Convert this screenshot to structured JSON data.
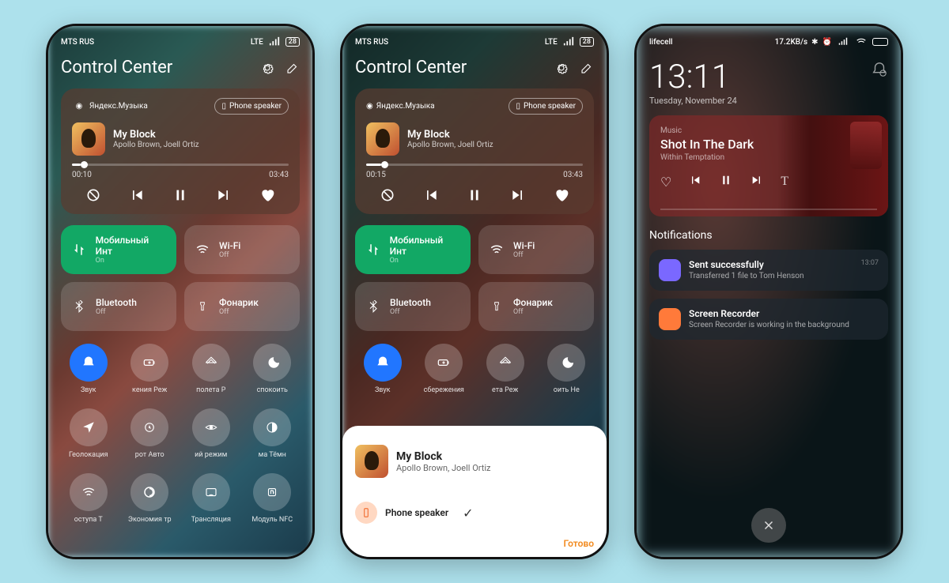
{
  "p1": {
    "status": {
      "carrier": "MTS RUS",
      "net": "LTE",
      "battery": "28"
    },
    "title": "Control Center",
    "music": {
      "source": "Яндекс.Музыка",
      "speaker": "Phone speaker",
      "track": "My Block",
      "artist": "Apollo Brown, Joell Ortiz",
      "elapsed": "00:10",
      "total": "03:43"
    },
    "tiles": [
      {
        "label": "Мобильный Инт",
        "state": "On",
        "on": true
      },
      {
        "label": "Wi-Fi",
        "state": "Off",
        "on": false
      },
      {
        "label": "Bluetooth",
        "state": "Off",
        "on": false
      },
      {
        "label": "Фонарик",
        "state": "Off",
        "on": false
      }
    ],
    "round": [
      {
        "label": "Звук",
        "on": true
      },
      {
        "label": "кения Реж"
      },
      {
        "label": "полета Р"
      },
      {
        "label": "спокоить"
      },
      {
        "label": "Геолокация"
      },
      {
        "label": "рот Авто"
      },
      {
        "label": "ий режим"
      },
      {
        "label": "ма Тёмн"
      },
      {
        "label": "оступа Т"
      },
      {
        "label": "Экономия тр"
      },
      {
        "label": "Трансляция"
      },
      {
        "label": "Модуль NFC"
      }
    ]
  },
  "p2": {
    "status": {
      "carrier": "MTS RUS",
      "net": "LTE",
      "battery": "28"
    },
    "title": "Control Center",
    "music": {
      "source": "Яндекс.Музыка",
      "speaker": "Phone speaker",
      "track": "My Block",
      "artist": "Apollo Brown, Joell Ortiz",
      "elapsed": "00:15",
      "total": "03:43"
    },
    "tiles": [
      {
        "label": "Мобильный Инт",
        "state": "On",
        "on": true
      },
      {
        "label": "Wi-Fi",
        "state": "Off",
        "on": false
      },
      {
        "label": "Bluetooth",
        "state": "Off",
        "on": false
      },
      {
        "label": "Фонарик",
        "state": "Off",
        "on": false
      }
    ],
    "round": [
      {
        "label": "Звук",
        "on": true
      },
      {
        "label": "сбережения"
      },
      {
        "label": "ета Реж"
      },
      {
        "label": "оить Не"
      }
    ],
    "sheet": {
      "track": "My Block",
      "artist": "Apollo Brown, Joell Ortiz",
      "option": "Phone speaker",
      "done": "Готово"
    }
  },
  "p3": {
    "status": {
      "carrier": "lifecell",
      "rate": "17.2KB/s"
    },
    "time": "13:11",
    "date": "Tuesday, November 24",
    "music": {
      "app": "Music",
      "track": "Shot In The Dark",
      "artist": "Within Temptation"
    },
    "notif_header": "Notifications",
    "notifs": [
      {
        "title": "Sent successfully",
        "desc": "Transferred 1 file to Tom Henson",
        "time": "13:07"
      },
      {
        "title": "Screen Recorder",
        "desc": "Screen Recorder is working in the background",
        "time": ""
      }
    ]
  }
}
